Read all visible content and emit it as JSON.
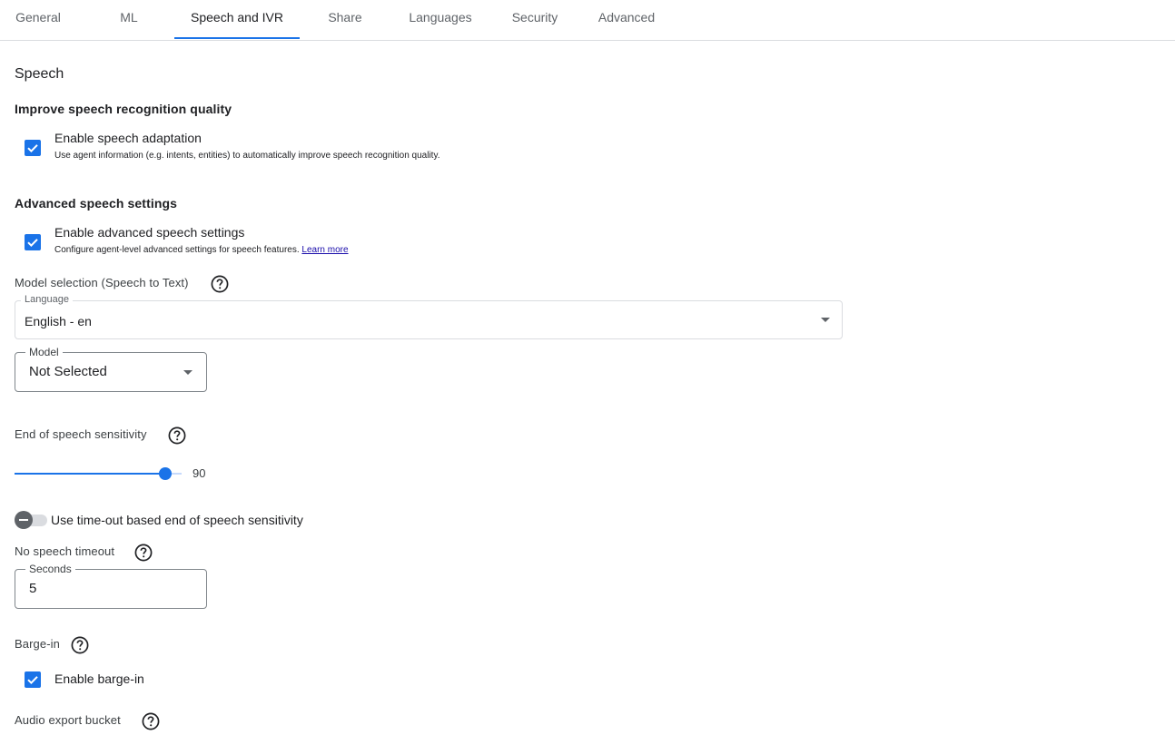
{
  "tabs": [
    {
      "label": "General"
    },
    {
      "label": "ML"
    },
    {
      "label": "Speech and IVR",
      "active": true
    },
    {
      "label": "Share"
    },
    {
      "label": "Languages"
    },
    {
      "label": "Security"
    },
    {
      "label": "Advanced"
    }
  ],
  "speech": {
    "title": "Speech",
    "improve_heading": "Improve speech recognition quality",
    "adaptation": {
      "checked": true,
      "label": "Enable speech adaptation",
      "hint": "Use agent information (e.g. intents, entities) to automatically improve speech recognition quality."
    },
    "advanced_heading": "Advanced speech settings",
    "advanced": {
      "checked": true,
      "label": "Enable advanced speech settings",
      "hint": "Configure agent-level advanced settings for speech features.",
      "link": "Learn more"
    },
    "model_selection": {
      "label": "Model selection (Speech to Text)",
      "language_label": "Language",
      "language_value": "English - en",
      "model_label": "Model",
      "model_value": "Not Selected"
    },
    "sensitivity": {
      "label": "End of speech sensitivity",
      "value": 90,
      "value_text": "90",
      "min": 0,
      "max": 100
    },
    "timeout_toggle": {
      "on": false,
      "label": "Use time-out based end of speech sensitivity"
    },
    "no_speech_timeout": {
      "label": "No speech timeout",
      "field_label": "Seconds",
      "value": "5"
    },
    "barge_in": {
      "label": "Barge-in",
      "checked": true,
      "checkbox_label": "Enable barge-in"
    },
    "audio_export": {
      "label": "Audio export bucket"
    }
  },
  "colors": {
    "accent": "#1a73e8",
    "text": "#202124",
    "muted": "#5f6368",
    "border": "#dadce0",
    "link": "#1a0dab"
  },
  "icons": [
    "check-icon",
    "help-circle-icon",
    "arrow-drop-down-icon"
  ]
}
